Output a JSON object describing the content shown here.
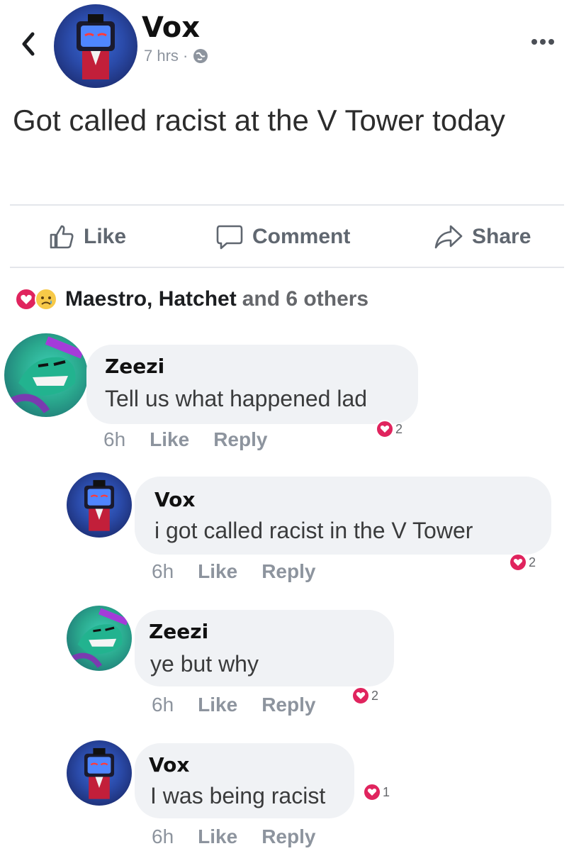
{
  "post": {
    "author": "Vox",
    "time": "7 hrs ·",
    "text": "Got called racist at the V Tower today"
  },
  "actions": {
    "like": "Like",
    "comment": "Comment",
    "share": "Share"
  },
  "reactions": {
    "names": "Maestro, Hatchet",
    "others": "and 6 others"
  },
  "comments": [
    {
      "author": "Zeezi",
      "text": "Tell us what happened lad",
      "time": "6h",
      "like": "Like",
      "reply": "Reply",
      "reactions": "2"
    },
    {
      "author": "Vox",
      "text": "i got called racist in the V Tower",
      "time": "6h",
      "like": "Like",
      "reply": "Reply",
      "reactions": "2"
    },
    {
      "author": "Zeezi",
      "text": "ye but why",
      "time": "6h",
      "like": "Like",
      "reply": "Reply",
      "reactions": "2"
    },
    {
      "author": "Vox",
      "text": "I was being racist",
      "time": "6h",
      "like": "Like",
      "reply": "Reply",
      "reactions": "1"
    }
  ],
  "colors": {
    "heart": "#e0245e",
    "muted": "#8d949e",
    "bubble": "#f0f2f5"
  },
  "icons": [
    "back-chevron-icon",
    "globe-icon",
    "more-options-icon",
    "thumbs-up-icon",
    "comment-icon",
    "share-arrow-icon",
    "love-reaction-icon",
    "sad-reaction-icon"
  ]
}
